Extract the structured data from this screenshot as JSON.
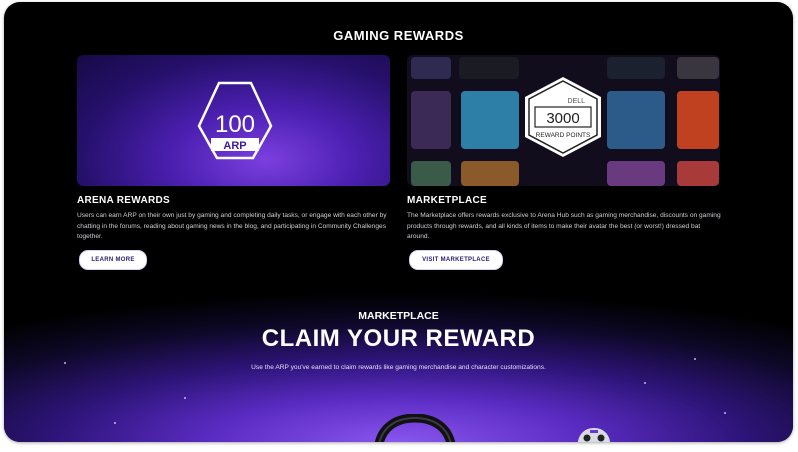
{
  "section": {
    "title": "GAMING REWARDS"
  },
  "arena": {
    "badge_number": "100",
    "badge_label": "ARP",
    "title": "ARENA REWARDS",
    "description": "Users can earn ARP on their own just by gaming and completing daily tasks, or engage with each other by chatting in the forums, reading about gaming news in the blog, and participating in Community Challenges together.",
    "button_label": "LEARN MORE"
  },
  "marketplace": {
    "badge_brand": "DELL",
    "badge_number": "3000",
    "badge_caption": "REWARD POINTS",
    "title": "MARKETPLACE",
    "description": "The Marketplace offers rewards exclusive to  Arena  Hub such as gaming merchandise, discounts on gaming products through rewards, and all kinds of items to make their avatar the best (or worst!) dressed bat around.",
    "button_label": "VISIT MARKETPLACE"
  },
  "hero": {
    "eyebrow": "MARKETPLACE",
    "title": "CLAIM YOUR REWARD",
    "subtitle": "Use the ARP you've earned to claim rewards like gaming merchandise and character customizations."
  },
  "colors": {
    "background": "#000000",
    "accent_purple": "#6a35d8",
    "button_text": "#2a1a6e"
  }
}
